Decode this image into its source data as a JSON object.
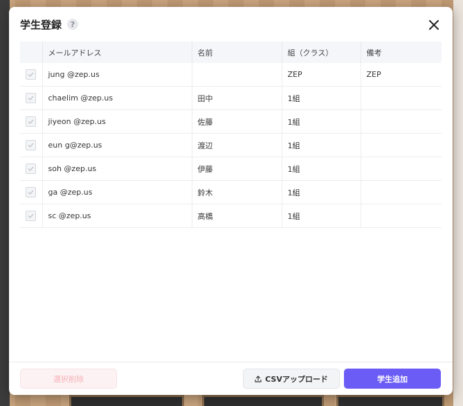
{
  "dialog": {
    "title": "学生登録",
    "help_glyph": "?",
    "close_icon": "close-icon"
  },
  "table": {
    "headers": [
      "",
      "メールアドレス",
      "名前",
      "組（クラス）",
      "備考"
    ],
    "rows": [
      {
        "email": "jung            @zep.us",
        "name": "",
        "class": "ZEP",
        "note": "ZEP"
      },
      {
        "email": "chaelim         @zep.us",
        "name": "田中",
        "class": "1組",
        "note": ""
      },
      {
        "email": "jiyeon          @zep.us",
        "name": "佐藤",
        "class": "1組",
        "note": ""
      },
      {
        "email": "eun              g@zep.us",
        "name": "渡辺",
        "class": "1組",
        "note": ""
      },
      {
        "email": "soh         @zep.us",
        "name": "伊藤",
        "class": "1組",
        "note": ""
      },
      {
        "email": "ga          @zep.us",
        "name": "鈴木",
        "class": "1組",
        "note": ""
      },
      {
        "email": "sc            @zep.us",
        "name": "高橋",
        "class": "1組",
        "note": ""
      }
    ]
  },
  "footer": {
    "delete_label": "選択削除",
    "csv_label": "CSVアップロード",
    "add_label": "学生追加"
  },
  "colors": {
    "accent": "#6b5cf6",
    "delete_text": "#f3b2b8",
    "header_bg": "#f5f6f9"
  }
}
